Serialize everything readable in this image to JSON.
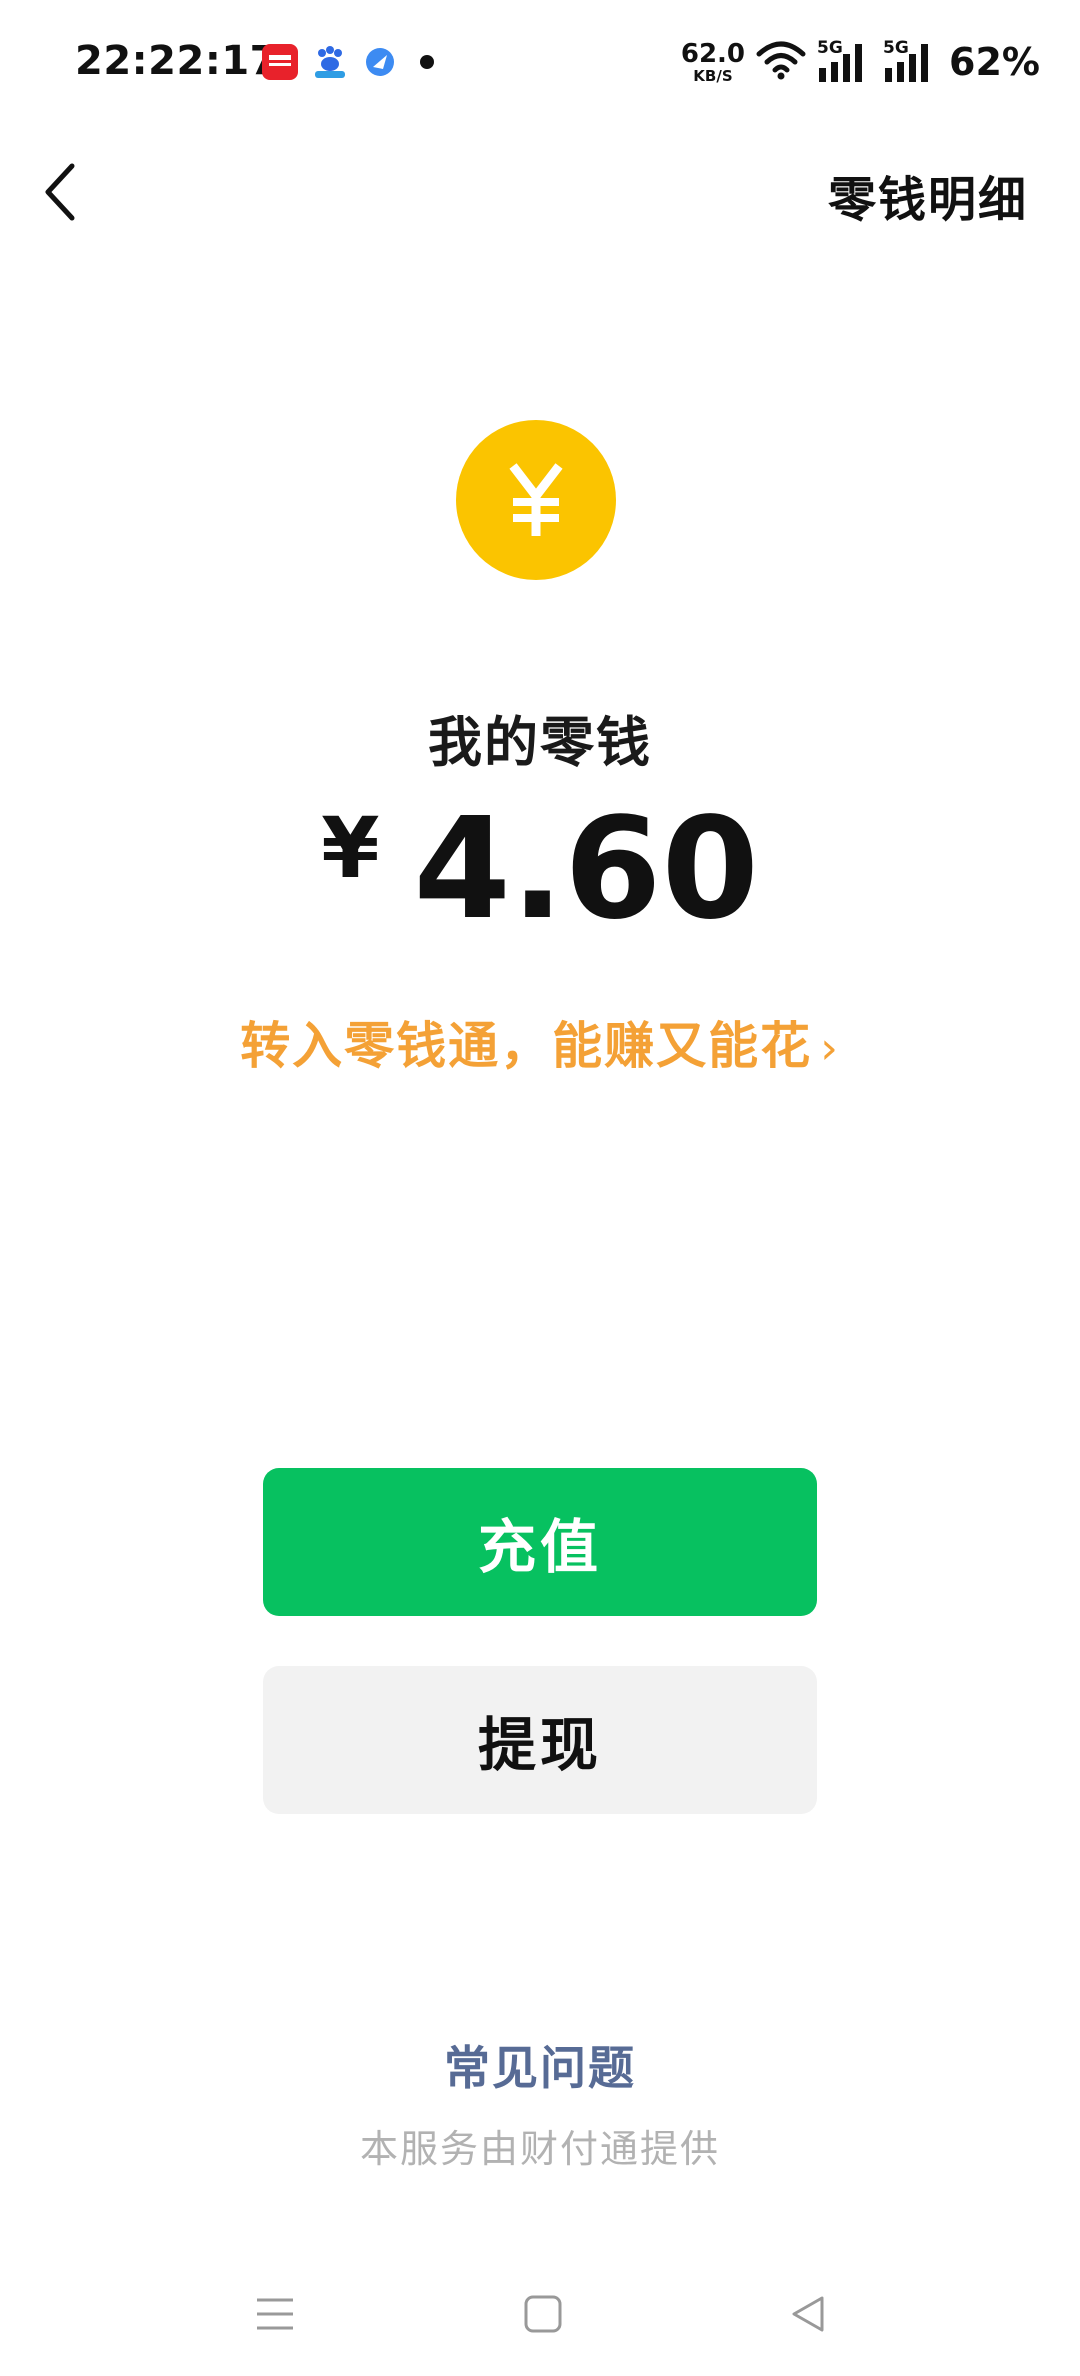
{
  "status_bar": {
    "time": "22:22:17",
    "net_speed_value": "62.0",
    "net_speed_unit": "KB/S",
    "signal_1_label": "5G",
    "signal_2_label": "5G",
    "battery": "62%",
    "notification_icons": [
      "app-red-icon",
      "baidu-icon",
      "blue-app-icon"
    ]
  },
  "header": {
    "back_icon": "chevron-left-icon",
    "action_label": "零钱明细"
  },
  "wallet": {
    "coin_symbol": "¥",
    "label": "我的零钱",
    "currency": "¥",
    "amount": "4.60",
    "promo_text": "转入零钱通，能赚又能花",
    "promo_chevron": "›"
  },
  "actions": {
    "recharge_label": "充值",
    "withdraw_label": "提现"
  },
  "footer": {
    "faq_label": "常见问题",
    "provider_text": "本服务由财付通提供"
  },
  "nav": {
    "items": [
      "menu-icon",
      "home-icon",
      "back-triangle-icon"
    ]
  },
  "colors": {
    "primary_green": "#07c160",
    "coin_yellow": "#fbc400",
    "promo_orange": "#f4a136",
    "link_blue": "#576b95",
    "muted_gray": "#b2b2b2"
  }
}
